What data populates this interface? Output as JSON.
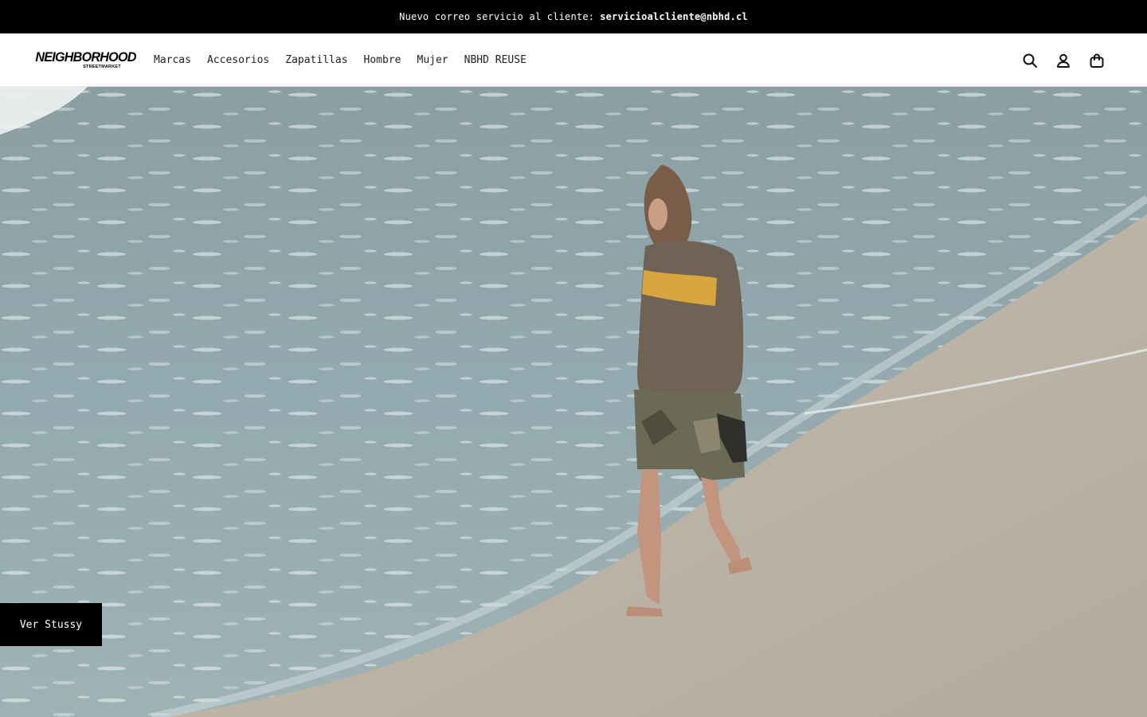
{
  "announcement": {
    "prefix": "Nuevo correo servicio al cliente:",
    "email": "servicioalcliente@nbhd.cl"
  },
  "header": {
    "logo": {
      "brand": "NEIGHBORHOOD",
      "sub": "STREETMARKET"
    },
    "nav": [
      {
        "label": "Marcas"
      },
      {
        "label": "Accesorios"
      },
      {
        "label": "Zapatillas"
      },
      {
        "label": "Hombre"
      },
      {
        "label": "Mujer"
      },
      {
        "label": "NBHD REUSE"
      }
    ],
    "icons": [
      "search-icon",
      "account-icon",
      "cart-icon"
    ]
  },
  "hero": {
    "image": "woman-walking-on-beach",
    "cta_label": "Ver Stussy"
  },
  "colors": {
    "announcement_bg": "#000000",
    "cta_bg": "#000000",
    "sea": "#8fa4a8",
    "sand": "#bab2a3"
  }
}
